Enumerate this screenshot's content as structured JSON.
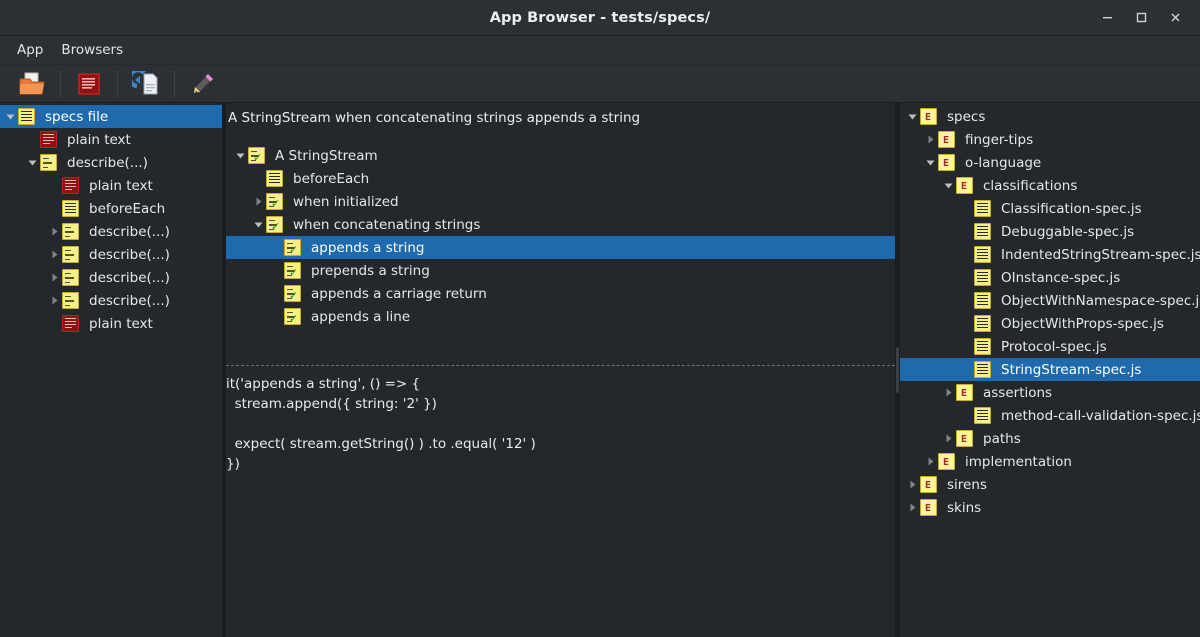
{
  "window": {
    "title": "App Browser - tests/specs/",
    "controls": {
      "minimize": "minimize-icon",
      "maximize": "maximize-icon",
      "close": "close-icon"
    }
  },
  "menubar": {
    "items": [
      {
        "label": "App"
      },
      {
        "label": "Browsers"
      }
    ]
  },
  "toolbar": {
    "buttons": [
      {
        "name": "open-folder-button",
        "icon": "open-folder-icon",
        "tooltip": "Open"
      },
      {
        "name": "specs-file-button",
        "icon": "red-note-icon",
        "tooltip": "Specs"
      },
      {
        "name": "reload-document-button",
        "icon": "reload-document-icon",
        "tooltip": "Reload"
      },
      {
        "name": "edit-pencil-button",
        "icon": "pencil-icon",
        "tooltip": "Edit"
      }
    ]
  },
  "left_pane": {
    "rows": [
      {
        "label": "specs file",
        "indent": 0,
        "twisty": "down",
        "icon": "note-yellow-lines",
        "selected": true
      },
      {
        "label": "plain text",
        "indent": 1,
        "twisty": "none",
        "icon": "note-red",
        "selected": false
      },
      {
        "label": "describe(...)",
        "indent": 1,
        "twisty": "down",
        "icon": "note-yellow-dots",
        "selected": false
      },
      {
        "label": "plain text",
        "indent": 2,
        "twisty": "none",
        "icon": "note-red",
        "selected": false
      },
      {
        "label": "beforeEach",
        "indent": 2,
        "twisty": "none",
        "icon": "note-yellow-lines",
        "selected": false
      },
      {
        "label": "describe(...)",
        "indent": 2,
        "twisty": "right",
        "icon": "note-yellow-dots",
        "selected": false
      },
      {
        "label": "describe(...)",
        "indent": 2,
        "twisty": "right",
        "icon": "note-yellow-dots",
        "selected": false
      },
      {
        "label": "describe(...)",
        "indent": 2,
        "twisty": "right",
        "icon": "note-yellow-dots",
        "selected": false
      },
      {
        "label": "describe(...)",
        "indent": 2,
        "twisty": "right",
        "icon": "note-yellow-dots",
        "selected": false
      },
      {
        "label": "plain text",
        "indent": 2,
        "twisty": "none",
        "icon": "note-red",
        "selected": false
      }
    ]
  },
  "mid_pane": {
    "header": "A StringStream when concatenating strings appends a string",
    "rows": [
      {
        "label": "A StringStream",
        "indent": 0,
        "twisty": "down",
        "icon": "note-yellow-check",
        "selected": false
      },
      {
        "label": "beforeEach",
        "indent": 1,
        "twisty": "none",
        "icon": "note-yellow-lines",
        "selected": false
      },
      {
        "label": "when initialized",
        "indent": 1,
        "twisty": "right",
        "icon": "note-yellow-check",
        "selected": false
      },
      {
        "label": "when concatenating strings",
        "indent": 1,
        "twisty": "down",
        "icon": "note-yellow-check",
        "selected": false
      },
      {
        "label": "appends a string",
        "indent": 2,
        "twisty": "none",
        "icon": "note-yellow-check",
        "selected": true
      },
      {
        "label": "prepends a string",
        "indent": 2,
        "twisty": "none",
        "icon": "note-yellow-check",
        "selected": false
      },
      {
        "label": "appends a carriage return",
        "indent": 2,
        "twisty": "none",
        "icon": "note-yellow-check",
        "selected": false
      },
      {
        "label": "appends a line",
        "indent": 2,
        "twisty": "none",
        "icon": "note-yellow-check",
        "selected": false
      }
    ],
    "code": [
      "it('appends a string', () => {",
      "  stream.append({ string: '2' })",
      "",
      "  expect( stream.getString() ) .to .equal( '12' )",
      "})"
    ]
  },
  "right_pane": {
    "rows": [
      {
        "label": "specs",
        "indent": 0,
        "twisty": "down",
        "icon": "folder",
        "selected": false
      },
      {
        "label": "finger-tips",
        "indent": 1,
        "twisty": "right",
        "icon": "folder",
        "selected": false
      },
      {
        "label": "o-language",
        "indent": 1,
        "twisty": "down",
        "icon": "folder",
        "selected": false
      },
      {
        "label": "classifications",
        "indent": 2,
        "twisty": "down",
        "icon": "folder",
        "selected": false
      },
      {
        "label": "Classification-spec.js",
        "indent": 3,
        "twisty": "none",
        "icon": "note-yellow-lines",
        "selected": false
      },
      {
        "label": "Debuggable-spec.js",
        "indent": 3,
        "twisty": "none",
        "icon": "note-yellow-lines",
        "selected": false
      },
      {
        "label": "IndentedStringStream-spec.js",
        "indent": 3,
        "twisty": "none",
        "icon": "note-yellow-lines",
        "selected": false
      },
      {
        "label": "OInstance-spec.js",
        "indent": 3,
        "twisty": "none",
        "icon": "note-yellow-lines",
        "selected": false
      },
      {
        "label": "ObjectWithNamespace-spec.js",
        "indent": 3,
        "twisty": "none",
        "icon": "note-yellow-lines",
        "selected": false
      },
      {
        "label": "ObjectWithProps-spec.js",
        "indent": 3,
        "twisty": "none",
        "icon": "note-yellow-lines",
        "selected": false
      },
      {
        "label": "Protocol-spec.js",
        "indent": 3,
        "twisty": "none",
        "icon": "note-yellow-lines",
        "selected": false
      },
      {
        "label": "StringStream-spec.js",
        "indent": 3,
        "twisty": "none",
        "icon": "note-yellow-lines",
        "selected": true
      },
      {
        "label": "assertions",
        "indent": 2,
        "twisty": "right",
        "icon": "folder",
        "selected": false
      },
      {
        "label": "method-call-validation-spec.js",
        "indent": 3,
        "twisty": "none",
        "icon": "note-yellow-lines",
        "selected": false
      },
      {
        "label": "paths",
        "indent": 2,
        "twisty": "right",
        "icon": "folder",
        "selected": false
      },
      {
        "label": "implementation",
        "indent": 1,
        "twisty": "right",
        "icon": "folder",
        "selected": false
      },
      {
        "label": "sirens",
        "indent": 0,
        "twisty": "right",
        "icon": "folder",
        "selected": false
      },
      {
        "label": "skins",
        "indent": 0,
        "twisty": "right",
        "icon": "folder",
        "selected": false
      }
    ]
  },
  "colors": {
    "selection": "#1f6aad",
    "background": "#24282c",
    "titlebar": "#2b3034",
    "text": "#e3e8ec",
    "icon_yellow": "#f6f08a",
    "icon_red": "#8e1212",
    "check_green": "#1f9b2f"
  }
}
